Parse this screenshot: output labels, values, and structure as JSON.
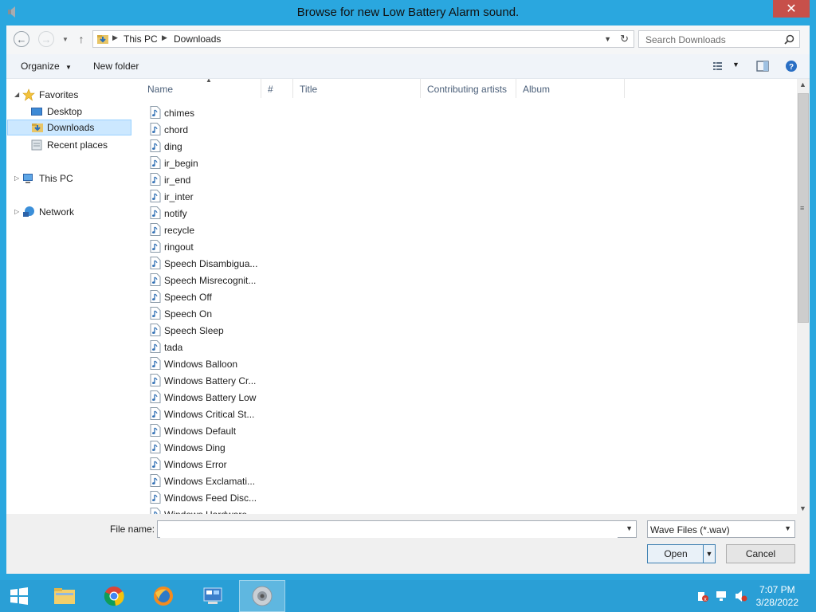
{
  "window": {
    "title": "Browse for new Low Battery Alarm sound.",
    "close_label": "✕"
  },
  "address": {
    "crumbs": [
      "This PC",
      "Downloads"
    ]
  },
  "search": {
    "placeholder": "Search Downloads"
  },
  "toolbar": {
    "organize_label": "Organize",
    "new_folder_label": "New folder"
  },
  "navpane": {
    "favorites": "Favorites",
    "desktop": "Desktop",
    "downloads": "Downloads",
    "recent": "Recent places",
    "this_pc": "This PC",
    "network": "Network"
  },
  "columns": [
    "Name",
    "#",
    "Title",
    "Contributing artists",
    "Album"
  ],
  "files": [
    "chimes",
    "chord",
    "ding",
    "ir_begin",
    "ir_end",
    "ir_inter",
    "notify",
    "recycle",
    "ringout",
    "Speech Disambigua...",
    "Speech Misrecognit...",
    "Speech Off",
    "Speech On",
    "Speech Sleep",
    "tada",
    "Windows Balloon",
    "Windows Battery Cr...",
    "Windows Battery Low",
    "Windows Critical St...",
    "Windows Default",
    "Windows Ding",
    "Windows Error",
    "Windows Exclamati...",
    "Windows Feed Disc...",
    "Windows Hardware..."
  ],
  "filename": {
    "label": "File name:",
    "value": ""
  },
  "filetype": {
    "value": "Wave Files (*.wav)"
  },
  "buttons": {
    "open": "Open",
    "cancel": "Cancel"
  },
  "clock": {
    "time": "7:07 PM",
    "date": "3/28/2022"
  },
  "colors": {
    "titlebar": "#2aa7df",
    "close": "#c7504a",
    "selection": "#cce8ff"
  }
}
